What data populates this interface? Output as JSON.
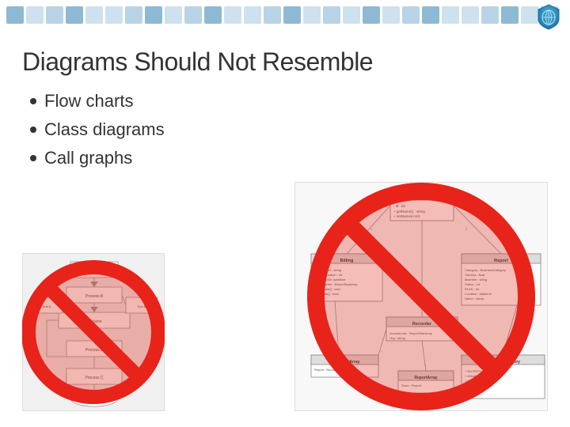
{
  "page": {
    "title": "Diagrams Should Not Resemble",
    "background_color": "#ffffff"
  },
  "header": {
    "logo_label": "logo-icon"
  },
  "bullet_items": [
    {
      "id": "flow-charts",
      "label": "Flow charts"
    },
    {
      "id": "class-diagrams",
      "label": "Class diagrams"
    },
    {
      "id": "call-graphs",
      "label": "Call graphs"
    }
  ],
  "no_symbol": {
    "color": "#e8231a",
    "stroke_width": 22
  }
}
